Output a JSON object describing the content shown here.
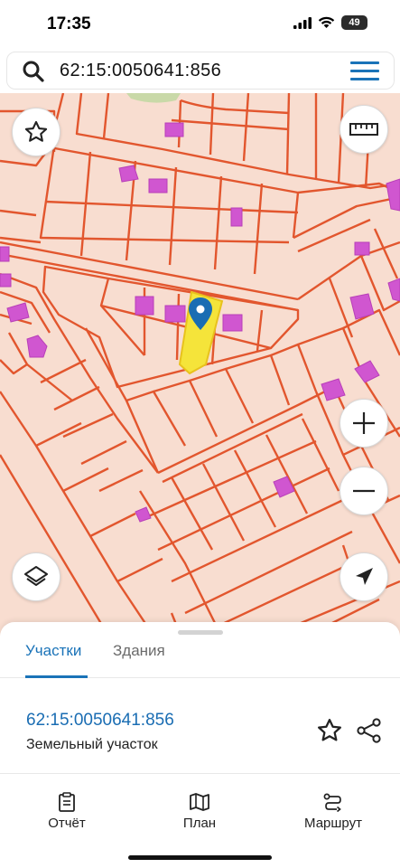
{
  "status_bar": {
    "time": "17:35",
    "battery": "49"
  },
  "search": {
    "value": "62:15:0050641:856"
  },
  "map": {
    "parcel_color": "#e2562e",
    "building_color": "#d056d0",
    "selected_color": "#f5e43a",
    "marker_color": "#1a6db3",
    "controls": [
      "favorite-icon",
      "ruler-icon",
      "zoom-in-icon",
      "zoom-out-icon",
      "layers-icon",
      "locate-icon"
    ]
  },
  "sheet": {
    "tabs": [
      {
        "label": "Участки",
        "active": true
      },
      {
        "label": "Здания",
        "active": false
      }
    ],
    "parcel": {
      "number": "62:15:0050641:856",
      "type": "Земельный участок"
    }
  },
  "nav": {
    "items": [
      {
        "label": "Отчёт",
        "icon": "report-icon"
      },
      {
        "label": "План",
        "icon": "map-plan-icon"
      },
      {
        "label": "Маршрут",
        "icon": "route-icon"
      }
    ]
  }
}
